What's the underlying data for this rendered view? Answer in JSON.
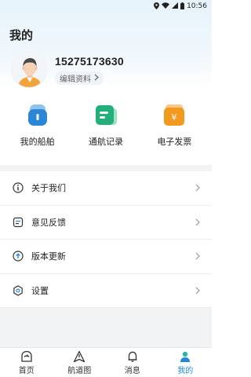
{
  "status": {
    "time": "10:56"
  },
  "page": {
    "title": "我的"
  },
  "profile": {
    "phone": "15275173630",
    "edit_label": "编辑资料"
  },
  "quick_actions": [
    {
      "label": "我的船舶",
      "icon": "ship-icon"
    },
    {
      "label": "通航记录",
      "icon": "record-icon"
    },
    {
      "label": "电子发票",
      "icon": "invoice-icon"
    }
  ],
  "menu": [
    {
      "label": "关于我们",
      "icon": "info-icon"
    },
    {
      "label": "意见反馈",
      "icon": "feedback-icon"
    },
    {
      "label": "版本更新",
      "icon": "update-icon"
    },
    {
      "label": "设置",
      "icon": "settings-icon"
    }
  ],
  "tabs": [
    {
      "label": "首页",
      "icon": "home-icon",
      "active": false
    },
    {
      "label": "航道图",
      "icon": "route-icon",
      "active": false
    },
    {
      "label": "消息",
      "icon": "bell-icon",
      "active": false
    },
    {
      "label": "我的",
      "icon": "user-icon",
      "active": true
    }
  ],
  "colors": {
    "accent": "#1e88e5",
    "ship": "#2b86d6",
    "record": "#21b07a",
    "invoice": "#f39a1e"
  }
}
